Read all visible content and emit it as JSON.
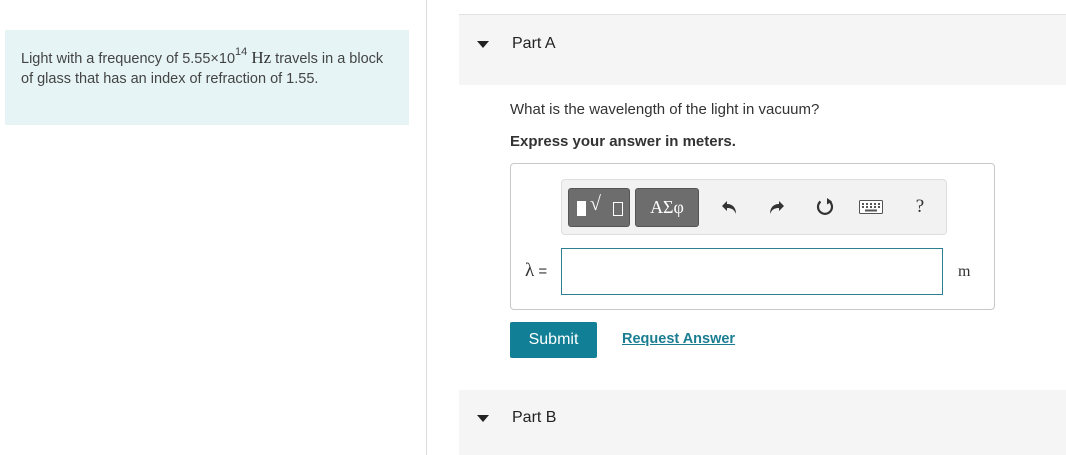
{
  "problem": {
    "text_before": "Light with a frequency of 5.55×10",
    "exponent": "14",
    "unit": "Hz",
    "text_after": " travels in a block of glass that has an index of refraction of 1.55."
  },
  "part_a": {
    "title": "Part A",
    "question": "What is the wavelength of the light in vacuum?",
    "instruction": "Express your answer in meters.",
    "toolbar": {
      "templates_icon": "templates-icon",
      "symbols_label": "ΑΣφ",
      "undo_icon": "undo-icon",
      "redo_icon": "redo-icon",
      "reset_icon": "reset-icon",
      "keyboard_icon": "keyboard-icon",
      "help_label": "?"
    },
    "answer_label_symbol": "λ",
    "answer_label_equals": " =",
    "answer_value": "",
    "answer_unit": "m",
    "submit_label": "Submit",
    "request_label": "Request Answer"
  },
  "part_b": {
    "title": "Part B"
  },
  "colors": {
    "problem_bg": "#e6f4f5",
    "accent": "#117f95",
    "link": "#1a7d92",
    "header_bg": "#f5f5f5"
  }
}
